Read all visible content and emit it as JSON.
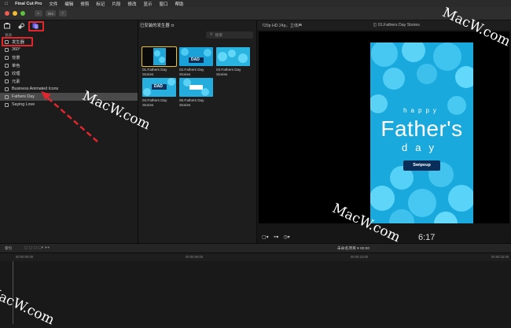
{
  "menubar": {
    "app_name": "Final Cut Pro",
    "items": [
      "文件",
      "编辑",
      "修剪",
      "标记",
      "片段",
      "修改",
      "显示",
      "窗口",
      "帮助"
    ]
  },
  "toolbar": {
    "download_label": "⇣",
    "key_label": "Om",
    "check_label": "✓"
  },
  "sidebar": {
    "clipped_label": "发表",
    "items": [
      {
        "label": "发生器",
        "selected": false
      },
      {
        "label": "360°",
        "selected": false
      },
      {
        "label": "背景",
        "selected": false
      },
      {
        "label": "单色",
        "selected": false
      },
      {
        "label": "纹理",
        "selected": false
      },
      {
        "label": "元素",
        "selected": false
      },
      {
        "label": "Business Animated Icons",
        "selected": false
      },
      {
        "label": "Fathers Day",
        "selected": true
      },
      {
        "label": "Saying Love",
        "selected": false
      }
    ]
  },
  "browser": {
    "title": "已安装的发生器 ≎",
    "search_placeholder": "搜索",
    "thumbnails": [
      {
        "label": "01.Fathers Day Stories",
        "selected": true
      },
      {
        "label": "02.Fathers Day Stories",
        "selected": false
      },
      {
        "label": "03.Fathers Day Stories",
        "selected": false
      },
      {
        "label": "04.Fathers Day Stories",
        "selected": false
      },
      {
        "label": "05.Fathers Day Stories",
        "selected": false
      }
    ],
    "thumb_text": "DAD"
  },
  "viewer": {
    "format": "720p HD 24p，立体声",
    "clip_name": "01.Fathers Day Stories",
    "poster": {
      "line1": "happy",
      "line2": "Father's",
      "line3": "day",
      "button": "Swipeup"
    },
    "timecode": "6:17"
  },
  "timeline": {
    "index_label": "索引",
    "project_name": "未命名项目",
    "project_duration": "00:00",
    "ruler_marks": [
      "00:00:00:00",
      "00:00:05:00",
      "00:00:10:00",
      "00:00:15:00"
    ]
  },
  "watermark_text": "MacW.com",
  "colors": {
    "highlight_red": "#e3262c",
    "selection_yellow": "#e9c230",
    "poster_blue": "#1fb0dd",
    "generator_tab": "#8a7dff"
  }
}
